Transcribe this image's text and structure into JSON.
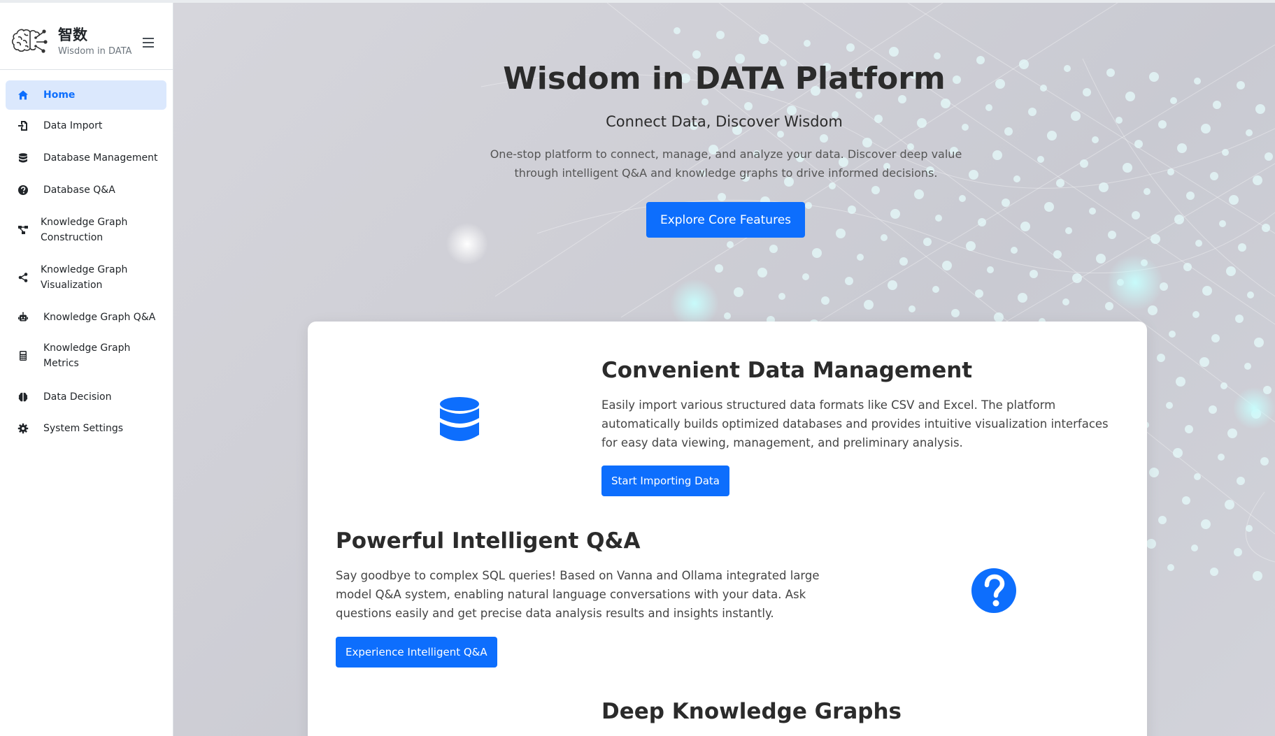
{
  "brand": {
    "name": "智数",
    "subtitle": "Wisdom in DATA"
  },
  "sidebar": {
    "items": [
      {
        "label": "Home",
        "icon": "home-icon",
        "active": true
      },
      {
        "label": "Data Import",
        "icon": "file-import-icon"
      },
      {
        "label": "Database Management",
        "icon": "database-icon"
      },
      {
        "label": "Database Q&A",
        "icon": "question-circle-icon"
      },
      {
        "label_line1": "Knowledge Graph",
        "label_line2": "Construction",
        "icon": "project-diagram-icon"
      },
      {
        "label_line1": "Knowledge Graph",
        "label_line2": "Visualization",
        "icon": "share-nodes-icon"
      },
      {
        "label": "Knowledge Graph Q&A",
        "icon": "robot-icon"
      },
      {
        "label_line1": "Knowledge Graph",
        "label_line2": "Metrics",
        "icon": "calculator-icon"
      },
      {
        "label": "Data Decision",
        "icon": "brain-icon"
      },
      {
        "label": "System Settings",
        "icon": "gear-icon"
      }
    ]
  },
  "hero": {
    "title": "Wisdom in DATA Platform",
    "subtitle": "Connect Data, Discover Wisdom",
    "description": "One-stop platform to connect, manage, and analyze your data. Discover deep value through intelligent Q&A and knowledge graphs to drive informed decisions.",
    "button": "Explore Core Features"
  },
  "features": [
    {
      "title": "Convenient Data Management",
      "text": "Easily import various structured data formats like CSV and Excel. The platform automatically builds optimized databases and provides intuitive visualization interfaces for easy data viewing, management, and preliminary analysis.",
      "button": "Start Importing Data",
      "icon": "database-icon"
    },
    {
      "title": "Powerful Intelligent Q&A",
      "text": "Say goodbye to complex SQL queries! Based on Vanna and Ollama integrated large model Q&A system, enabling natural language conversations with your data. Ask questions easily and get precise data analysis results and insights instantly.",
      "button": "Experience Intelligent Q&A",
      "icon": "question-circle-icon"
    },
    {
      "title": "Deep Knowledge Graphs"
    }
  ],
  "colors": {
    "primary": "#0d6efd",
    "active_bg": "#dbe8fd",
    "sidebar_border": "#dee2e6"
  }
}
